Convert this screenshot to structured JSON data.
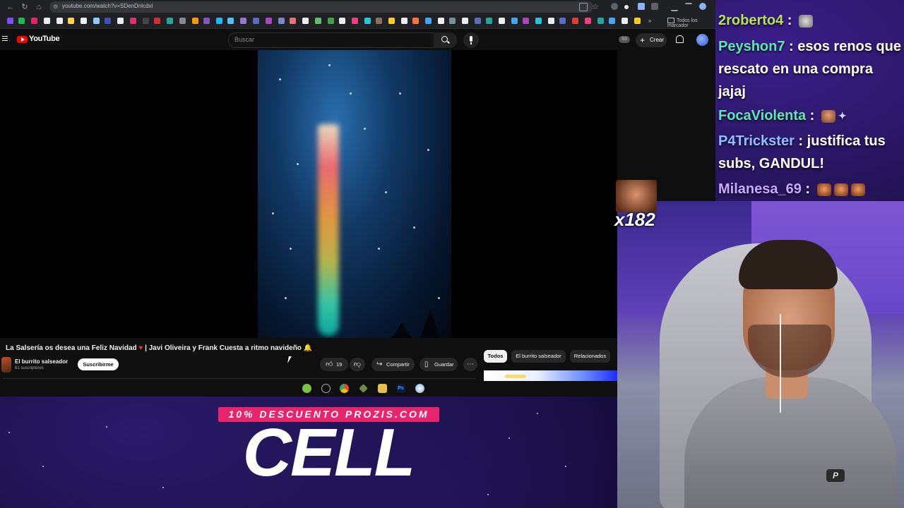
{
  "browser": {
    "url": "youtube.com/watch?v=SDenDnlcdxl",
    "bookmarks_folder": "Todos los marcador"
  },
  "youtube": {
    "logo_text": "YouTube",
    "search_placeholder": "Buscar",
    "ss_badge": "SS",
    "create_label": "Crear"
  },
  "video": {
    "title": "La Salsería os desea una Feliz Navidad",
    "title_rest": "| Javi Oliveira y Frank Cuesta a ritmo navideño",
    "channel_name": "El burrito salseador",
    "channel_subs": "61 suscriptores",
    "subscribe_label": "Suscribirme",
    "likes": "19",
    "share_label": "Compartir",
    "save_label": "Guardar"
  },
  "chips": [
    "Todos",
    "El burrito salseador",
    "Relacionados"
  ],
  "chat": [
    {
      "user": "2roberto4",
      "color": "#b8e05a",
      "message": ""
    },
    {
      "user": "Peyshon7",
      "color": "#5ee6b0",
      "message": "esos renos que rescato en una compra jajaj"
    },
    {
      "user": "FocaViolenta",
      "color": "#5ee6b0",
      "message": ""
    },
    {
      "user": "P4Trickster",
      "color": "#8fc0ff",
      "message": "justifica tus subs, GANDUL!"
    },
    {
      "user": "Milanesa_69",
      "color": "#c9a8ff",
      "message": ""
    }
  ],
  "emote_combo": "x182",
  "sponsor": {
    "promo": "10% DESCUENTO PROZIS.COM",
    "code": "CELL"
  },
  "icons": {
    "avatar_color": "#3954c9",
    "accent_red": "#ff0000",
    "promo_color": "#e8246a"
  }
}
